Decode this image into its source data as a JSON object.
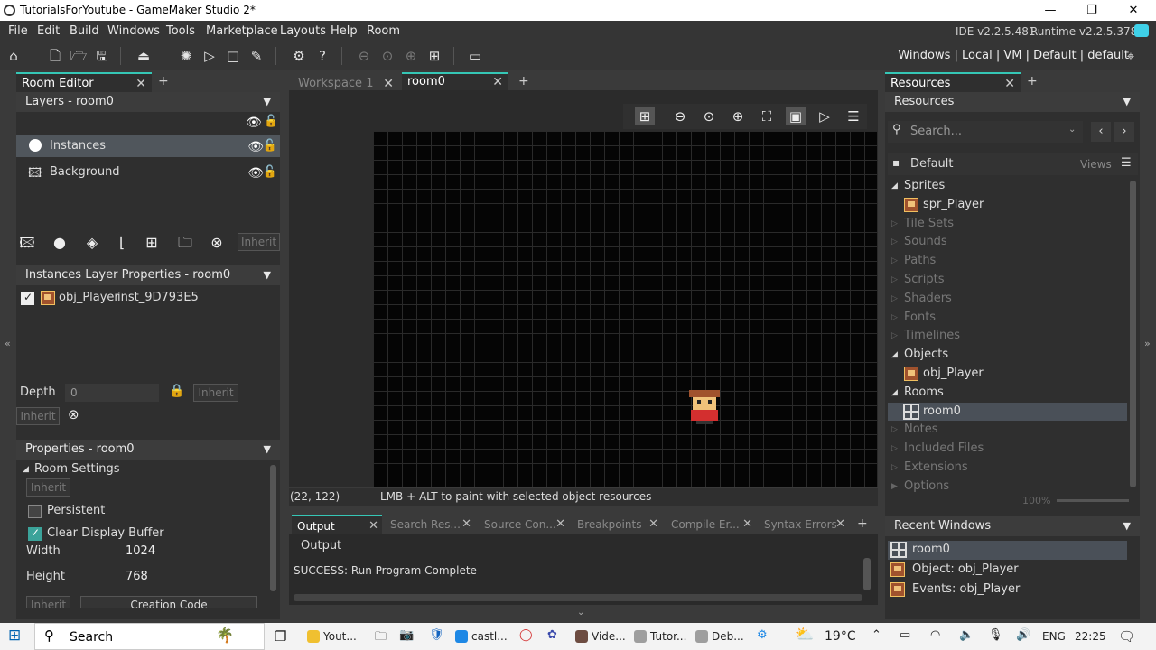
{
  "window": {
    "title": "TutorialsForYoutube - GameMaker Studio 2*",
    "min": "—",
    "max": "❐",
    "close": "✕"
  },
  "menu": {
    "items": [
      "File",
      "Edit",
      "Build",
      "Windows",
      "Tools",
      "Marketplace",
      "Layouts",
      "Help",
      "Room"
    ],
    "ide_version": "IDE v2.2.5.481",
    "runtime_version": "Runtime v2.2.5.378"
  },
  "toolbar": {
    "target": "Windows | Local | VM | Default | default"
  },
  "room_editor": {
    "tab_label": "Room Editor",
    "layers_header": "Layers - room0",
    "layers": [
      {
        "name": "Instances"
      },
      {
        "name": "Background"
      }
    ],
    "inherit": "Inherit",
    "instances_header": "Instances Layer Properties - room0",
    "instance": {
      "object": "obj_Player",
      "id": "inst_9D793E5"
    },
    "depth_label": "Depth",
    "depth_value": "0",
    "properties_header": "Properties - room0",
    "room_settings": "Room Settings",
    "persistent": "Persistent",
    "clear_display": "Clear Display Buffer",
    "width_label": "Width",
    "width_value": "1024",
    "height_label": "Height",
    "height_value": "768",
    "creation_code": "Creation Code"
  },
  "workspace": {
    "tabs": [
      "Workspace 1",
      "room0"
    ],
    "coords": "(22, 122)",
    "hint": "LMB + ALT to paint with selected object resources"
  },
  "output": {
    "tabs": [
      "Output",
      "Search Res...",
      "Source Con...",
      "Breakpoints",
      "Compile Er...",
      "Syntax Errors"
    ],
    "heading": "Output",
    "line": "SUCCESS: Run Program Complete"
  },
  "resources": {
    "tab_label": "Resources",
    "header": "Resources",
    "search_placeholder": "Search...",
    "default": "Default",
    "views": "Views",
    "tree": [
      {
        "label": "Sprites",
        "open": true
      },
      {
        "label": "spr_Player",
        "child": true
      },
      {
        "label": "Tile Sets"
      },
      {
        "label": "Sounds"
      },
      {
        "label": "Paths"
      },
      {
        "label": "Scripts"
      },
      {
        "label": "Shaders"
      },
      {
        "label": "Fonts"
      },
      {
        "label": "Timelines"
      },
      {
        "label": "Objects",
        "open": true
      },
      {
        "label": "obj_Player",
        "child": true
      },
      {
        "label": "Rooms",
        "open": true
      },
      {
        "label": "room0",
        "child": true
      },
      {
        "label": "Notes"
      },
      {
        "label": "Included Files"
      },
      {
        "label": "Extensions"
      },
      {
        "label": "Options"
      }
    ],
    "zoom": "100%",
    "recent_header": "Recent Windows",
    "recent": [
      "room0",
      "Object: obj_Player",
      "Events: obj_Player"
    ]
  },
  "taskbar": {
    "search": "Search",
    "apps": [
      {
        "label": "Yout...",
        "color": "#f0c030"
      },
      {
        "label": "castl...",
        "color": "#1e88e5"
      },
      {
        "label": "Vide...",
        "color": "#6d4c41"
      },
      {
        "label": "Tutor...",
        "color": "#9e9e9e"
      },
      {
        "label": "Deb...",
        "color": "#9e9e9e"
      }
    ],
    "weather": "19°C",
    "lang": "ENG",
    "time": "22:25"
  }
}
